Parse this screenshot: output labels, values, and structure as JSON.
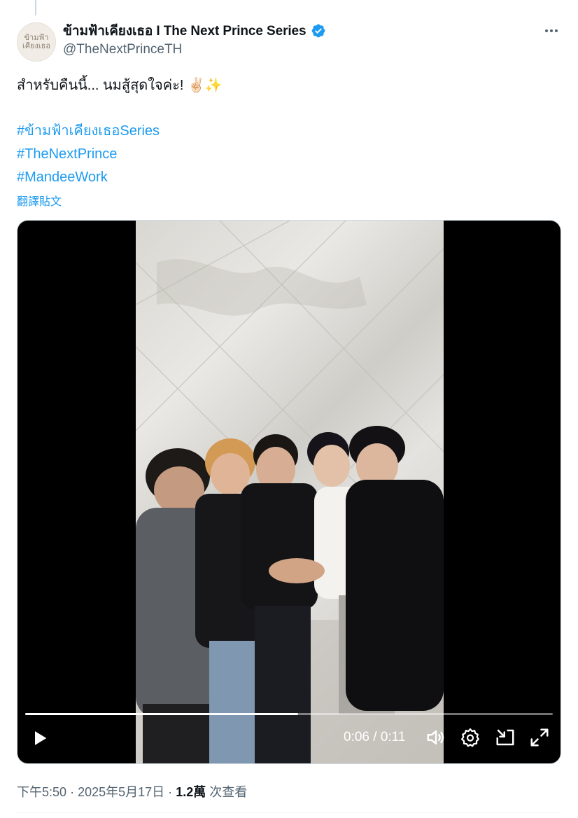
{
  "tweet": {
    "display_name": "ข้ามฟ้าเคียงเธอ I The Next Prince Series",
    "handle": "@TheNextPrinceTH",
    "avatar_text": "ข้ามฟ้าเคียงเธอ",
    "text_line": "สำหรับคืนนี้... นมสู้สุดใจค่ะ! ✌🏻✨",
    "hashtags": [
      "#ข้ามฟ้าเคียงเธอSeries",
      "#TheNextPrince",
      "#MandeeWork"
    ],
    "translate_label": "翻譯貼文",
    "more_icon": "more-icon",
    "verified_icon": "verified-badge-icon",
    "accent_color": "#1d9bf0"
  },
  "video": {
    "time_current": "0:06",
    "time_separator": "/",
    "time_total": "0:11",
    "progress": 0.517,
    "icons": [
      "play-icon",
      "volume-icon",
      "settings-icon",
      "picture-in-picture-icon",
      "fullscreen-icon"
    ]
  },
  "footer": {
    "time": "下午5:50",
    "sep1": "·",
    "date": "2025年5月17日",
    "sep2": "·",
    "views_count": "1.2萬",
    "views_label": "次查看"
  }
}
